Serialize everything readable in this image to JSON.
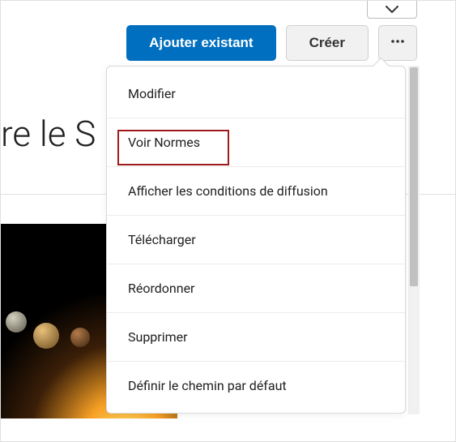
{
  "collapse": {
    "name": "chevron-down-icon"
  },
  "toolbar": {
    "add_existing_label": "Ajouter existant",
    "create_label": "Créer",
    "more_label": "…"
  },
  "page": {
    "title_partial": "re le S"
  },
  "dropdown": {
    "items": [
      {
        "label": "Modifier"
      },
      {
        "label": "Voir Normes"
      },
      {
        "label": "Afficher les conditions de diffusion"
      },
      {
        "label": "Télécharger"
      },
      {
        "label": "Réordonner"
      },
      {
        "label": "Supprimer"
      },
      {
        "label": "Définir le chemin par défaut"
      }
    ]
  }
}
